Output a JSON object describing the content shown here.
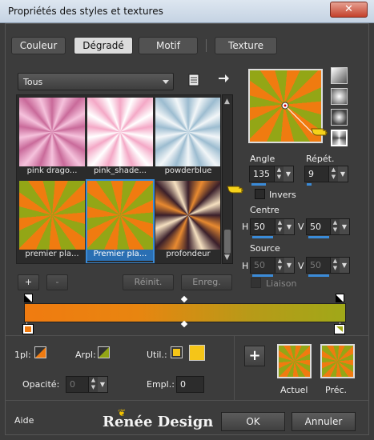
{
  "window": {
    "title": "Propriétés des styles et textures",
    "close_glyph": "✕"
  },
  "tabs": [
    {
      "label": "Couleur",
      "active": false
    },
    {
      "label": "Dégradé",
      "active": true
    },
    {
      "label": "Motif",
      "active": false
    },
    {
      "label": "Texture",
      "active": false
    }
  ],
  "library": {
    "category": "Tous",
    "items": [
      {
        "label": "pink drago...",
        "selected": false
      },
      {
        "label": "pink_shade...",
        "selected": false
      },
      {
        "label": "powderblue",
        "selected": false
      },
      {
        "label": "premier pla...",
        "selected": false
      },
      {
        "label": "Premier pla...",
        "selected": true
      },
      {
        "label": "profondeur",
        "selected": false
      }
    ],
    "add_label": "+",
    "remove_label": "-",
    "reset_label": "Réinit.",
    "save_label": "Enreg."
  },
  "gradient": {
    "angle_label": "Angle",
    "angle": "135",
    "repeat_label": "Répét.",
    "repeat": "9",
    "invert_label": "Invers",
    "center_label": "Centre",
    "center_h_label": "H",
    "center_h": "50",
    "center_v_label": "V",
    "center_v": "50",
    "source_label": "Source",
    "source_h_label": "H",
    "source_h": "50",
    "source_v_label": "V",
    "source_v": "50",
    "link_label": "Liaison",
    "colors": {
      "start": "#f07b10",
      "end": "#a0a818"
    }
  },
  "stops": {
    "fg_label": "1pl:",
    "bg_label": "Arpl:",
    "user_label": "Util.:",
    "opacity_label": "Opacité:",
    "opacity": "0",
    "location_label": "Empl.:",
    "location": "0",
    "user_color": "#f5c518"
  },
  "preview": {
    "current_label": "Actuel",
    "previous_label": "Préc.",
    "add_label": "+"
  },
  "footer": {
    "help_label": "Aide",
    "ok_label": "OK",
    "cancel_label": "Annuler",
    "logo_text": "Renée Design"
  }
}
